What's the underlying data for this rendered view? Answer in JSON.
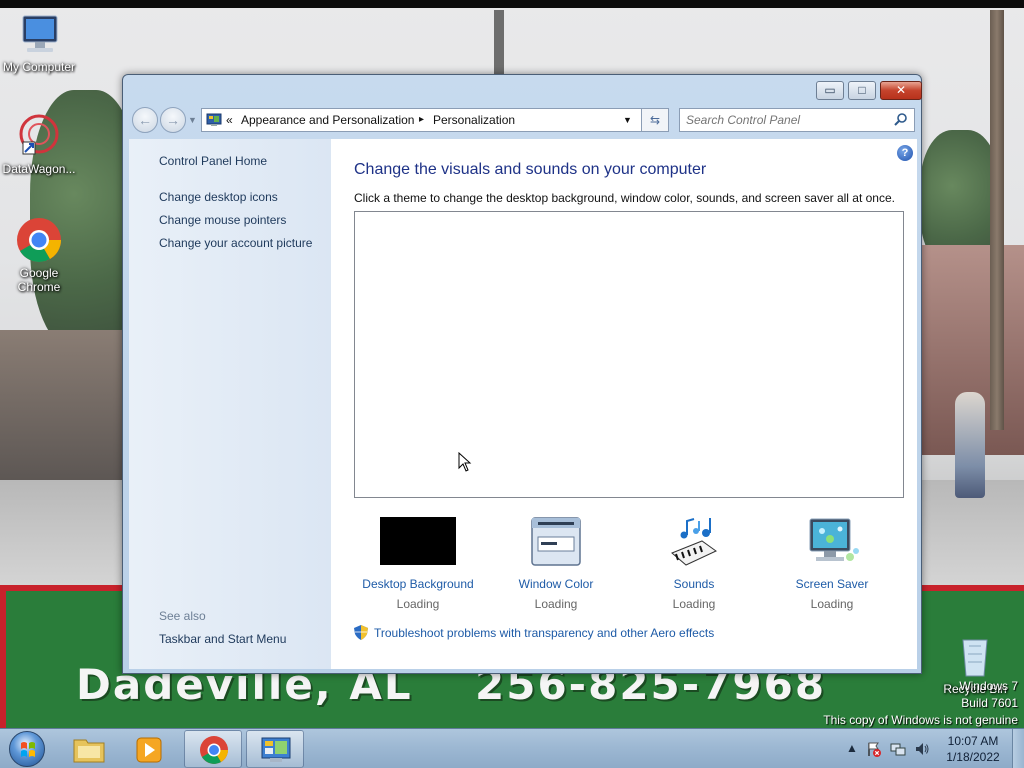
{
  "desktop": {
    "icons": [
      {
        "label": "My Computer",
        "icon": "computer-icon"
      },
      {
        "label": "DataWagon...",
        "icon": "datawagon-icon"
      },
      {
        "label": "Google Chrome",
        "icon": "chrome-icon"
      },
      {
        "label": "Recycle Bin",
        "icon": "recycle-bin-icon"
      }
    ],
    "banner_city": "Dadeville, AL",
    "banner_phone": "256-825-7968",
    "watermark": {
      "line1": "Windows 7",
      "line2": "Build 7601",
      "line3": "This copy of Windows is not genuine"
    }
  },
  "window": {
    "controls": {
      "minimize": "▭",
      "maximize": "□",
      "close": "✕"
    },
    "address": {
      "overflow": "«",
      "crumb1": "Appearance and Personalization",
      "sep": "▸",
      "crumb2": "Personalization"
    },
    "search": {
      "placeholder": "Search Control Panel"
    },
    "sidebar": {
      "home": "Control Panel Home",
      "links": [
        "Change desktop icons",
        "Change mouse pointers",
        "Change your account picture"
      ],
      "see_also_label": "See also",
      "see_also_links": [
        "Taskbar and Start Menu"
      ]
    },
    "main": {
      "title": "Change the visuals and sounds on your computer",
      "subtitle": "Click a theme to change the desktop background, window color, sounds, and screen saver all at once.",
      "help": "?",
      "tiles": [
        {
          "label": "Desktop Background",
          "status": "Loading",
          "icon": "desktop-background-icon"
        },
        {
          "label": "Window Color",
          "status": "Loading",
          "icon": "window-color-icon"
        },
        {
          "label": "Sounds",
          "status": "Loading",
          "icon": "sounds-icon"
        },
        {
          "label": "Screen Saver",
          "status": "Loading",
          "icon": "screen-saver-icon"
        }
      ],
      "troubleshoot": "Troubleshoot problems with transparency and other Aero effects"
    }
  },
  "taskbar": {
    "items": [
      "start-orb-icon",
      "file-explorer-icon",
      "media-player-icon",
      "chrome-icon",
      "control-panel-icon"
    ],
    "tray": {
      "time": "10:07 AM",
      "date": "1/18/2022"
    }
  }
}
